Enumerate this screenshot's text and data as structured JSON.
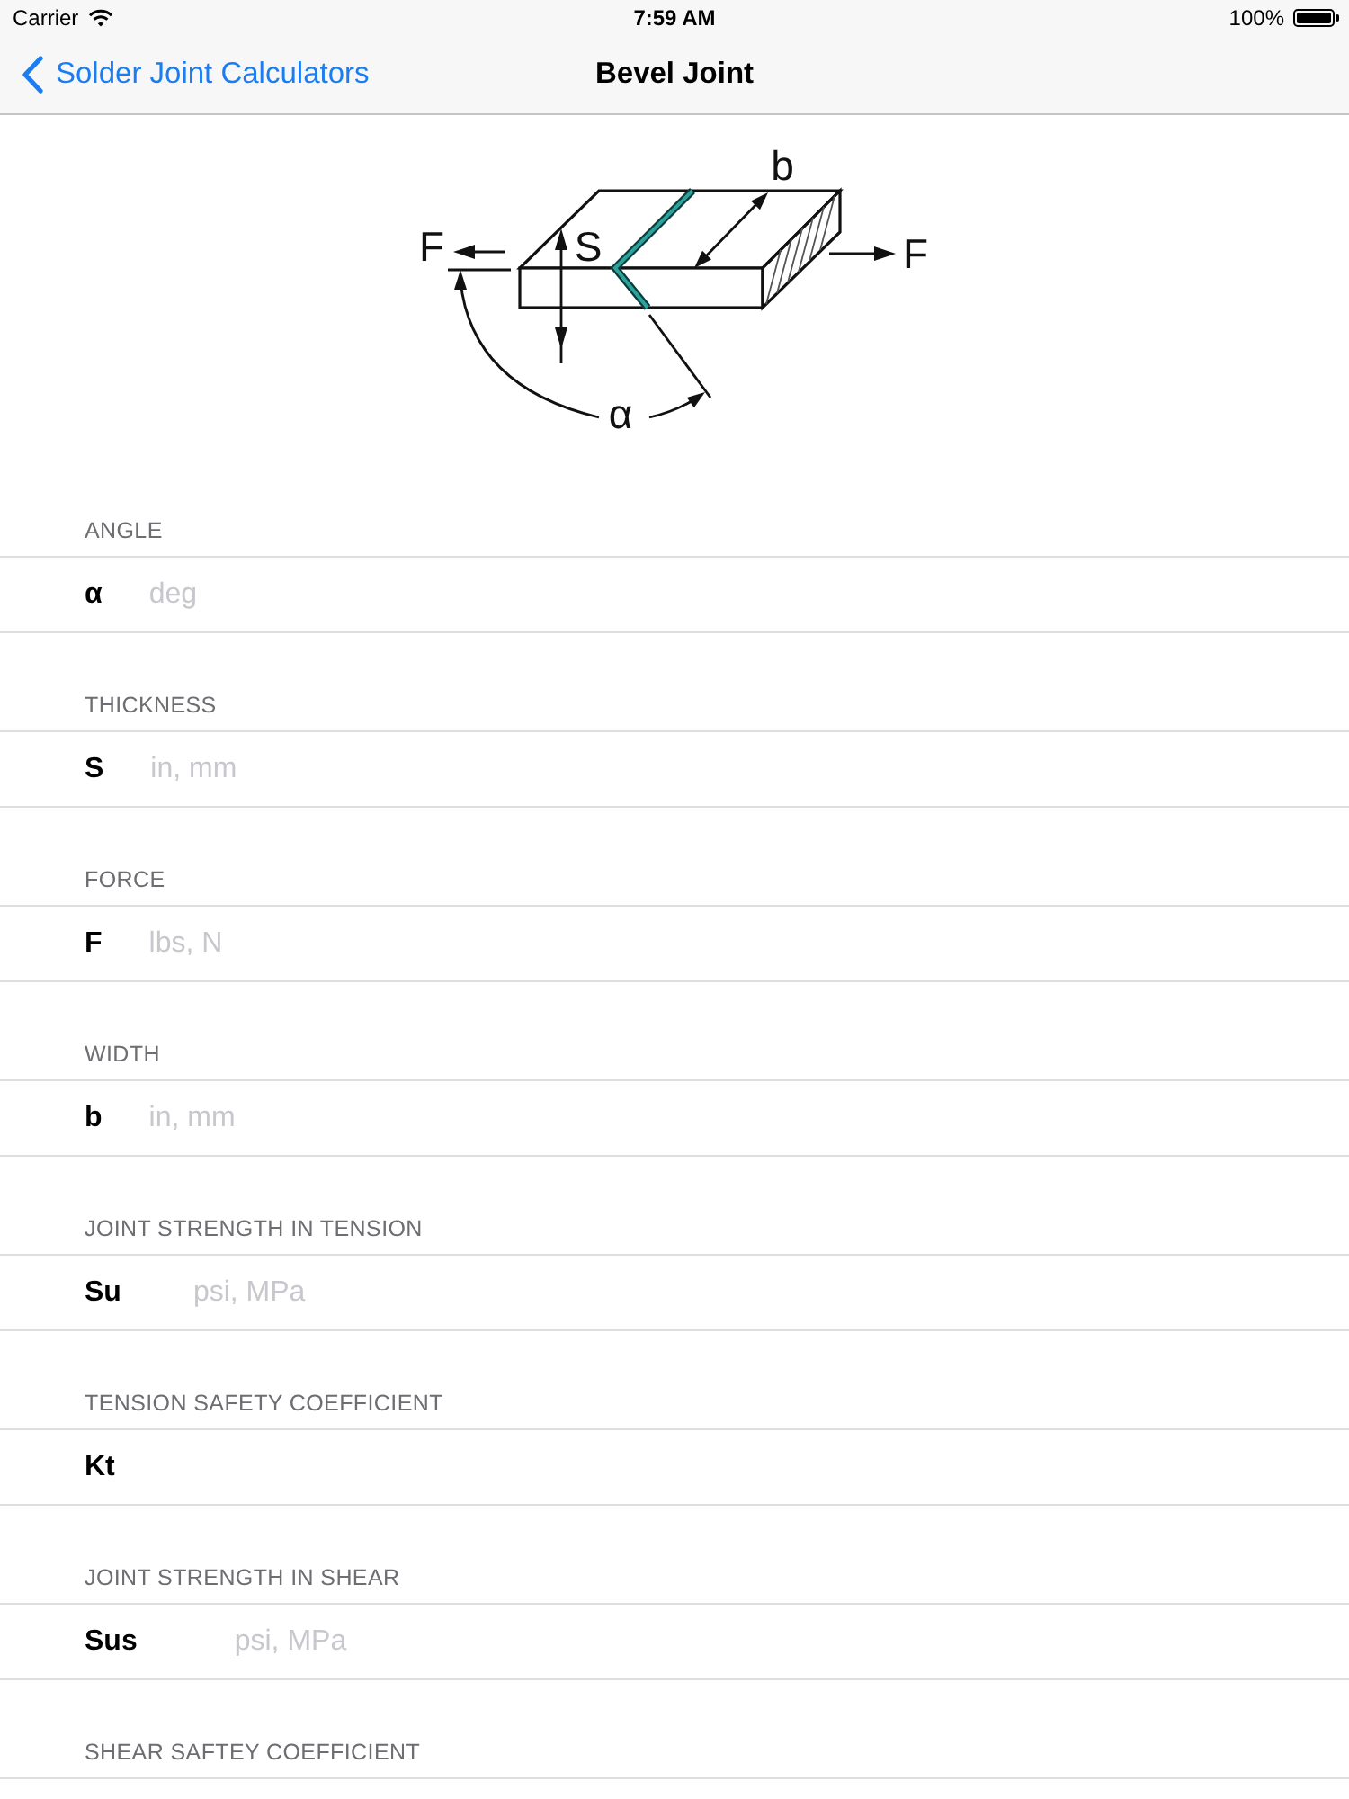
{
  "status_bar": {
    "carrier": "Carrier",
    "time": "7:59 AM",
    "battery": "100%"
  },
  "nav_bar": {
    "back_label": "Solder Joint Calculators",
    "title": "Bevel Joint"
  },
  "diagram": {
    "force_label_left": "F",
    "force_label_right": "F",
    "thickness_label": "S",
    "width_label": "b",
    "angle_label": "α"
  },
  "sections": [
    {
      "header": "ANGLE",
      "symbol": "α",
      "placeholder": "deg"
    },
    {
      "header": "THICKNESS",
      "symbol": "S",
      "placeholder": "in, mm"
    },
    {
      "header": "FORCE",
      "symbol": "F",
      "placeholder": "lbs, N"
    },
    {
      "header": "WIDTH",
      "symbol": "b",
      "placeholder": "in, mm"
    },
    {
      "header": "JOINT STRENGTH IN TENSION",
      "symbol": "Su",
      "placeholder": "psi, MPa"
    },
    {
      "header": "TENSION SAFETY COEFFICIENT",
      "symbol": "Kt"
    },
    {
      "header": "JOINT STRENGTH IN SHEAR",
      "symbol": "Sus",
      "placeholder": "psi, MPa"
    },
    {
      "header": "SHEAR SAFTEY COEFFICIENT"
    }
  ]
}
